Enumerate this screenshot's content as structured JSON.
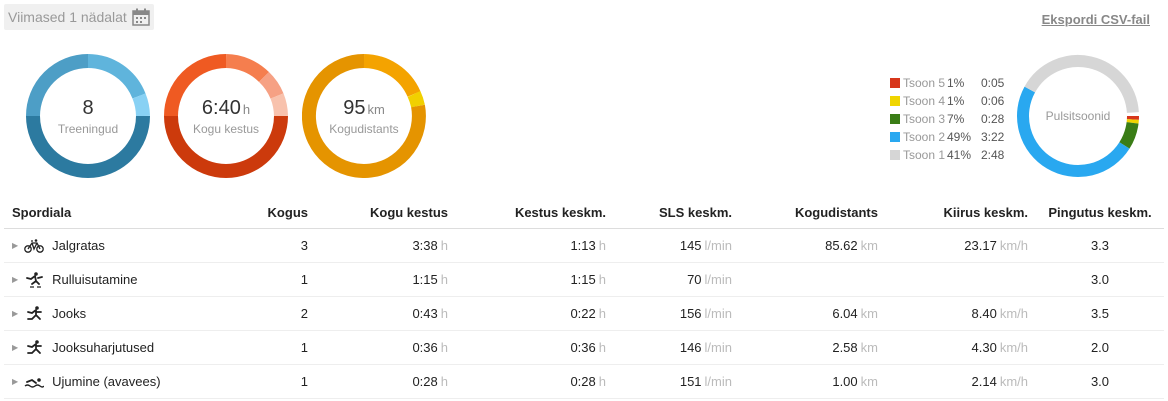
{
  "period": {
    "label": "Viimased 1 nädalat"
  },
  "export": {
    "label": "Ekspordi CSV-fail"
  },
  "rings": {
    "workouts": {
      "value": "8",
      "unit": "",
      "label": "Treeningud"
    },
    "duration": {
      "value": "6:40",
      "unit": "h",
      "label": "Kogu kestus"
    },
    "distance": {
      "value": "95",
      "unit": "km",
      "label": "Kogudistants"
    }
  },
  "hr": {
    "label": "Pulsitsoonid",
    "zones": [
      {
        "name": "Tsoon 5",
        "pct": "1%",
        "time": "0:05",
        "color": "#d7361b",
        "fraction": 0.01
      },
      {
        "name": "Tsoon 4",
        "pct": "1%",
        "time": "0:06",
        "color": "#f0d500",
        "fraction": 0.01
      },
      {
        "name": "Tsoon 3",
        "pct": "7%",
        "time": "0:28",
        "color": "#3a7d16",
        "fraction": 0.07
      },
      {
        "name": "Tsoon 2",
        "pct": "49%",
        "time": "3:22",
        "color": "#29a8f0",
        "fraction": 0.49
      },
      {
        "name": "Tsoon 1",
        "pct": "41%",
        "time": "2:48",
        "color": "#d6d6d6",
        "fraction": 0.41
      }
    ]
  },
  "table": {
    "headers": [
      "Spordiala",
      "Kogus",
      "Kogu kestus",
      "Kestus keskm.",
      "SLS keskm.",
      "Kogudistants",
      "Kiirus keskm.",
      "Pingutus keskm."
    ],
    "units": {
      "h": "h",
      "bpm": "l/min",
      "km": "km",
      "kmh": "km/h"
    },
    "rows": [
      {
        "icon": "bicycle-icon",
        "name": "Jalgratas",
        "count": "3",
        "total": "3:38",
        "avg": "1:13",
        "hr": "145",
        "dist": "85.62",
        "speed": "23.17",
        "effort": "3.3"
      },
      {
        "icon": "skating-icon",
        "name": "Rulluisutamine",
        "count": "1",
        "total": "1:15",
        "avg": "1:15",
        "hr": "70",
        "dist": "",
        "speed": "",
        "effort": "3.0"
      },
      {
        "icon": "running-icon",
        "name": "Jooks",
        "count": "2",
        "total": "0:43",
        "avg": "0:22",
        "hr": "156",
        "dist": "6.04",
        "speed": "8.40",
        "effort": "3.5"
      },
      {
        "icon": "running-icon",
        "name": "Jooksuharjutused",
        "count": "1",
        "total": "0:36",
        "avg": "0:36",
        "hr": "146",
        "dist": "2.58",
        "speed": "4.30",
        "effort": "2.0"
      },
      {
        "icon": "swimming-icon",
        "name": "Ujumine (avavees)",
        "count": "1",
        "total": "0:28",
        "avg": "0:28",
        "hr": "151",
        "dist": "1.00",
        "speed": "2.14",
        "effort": "3.0"
      }
    ]
  }
}
